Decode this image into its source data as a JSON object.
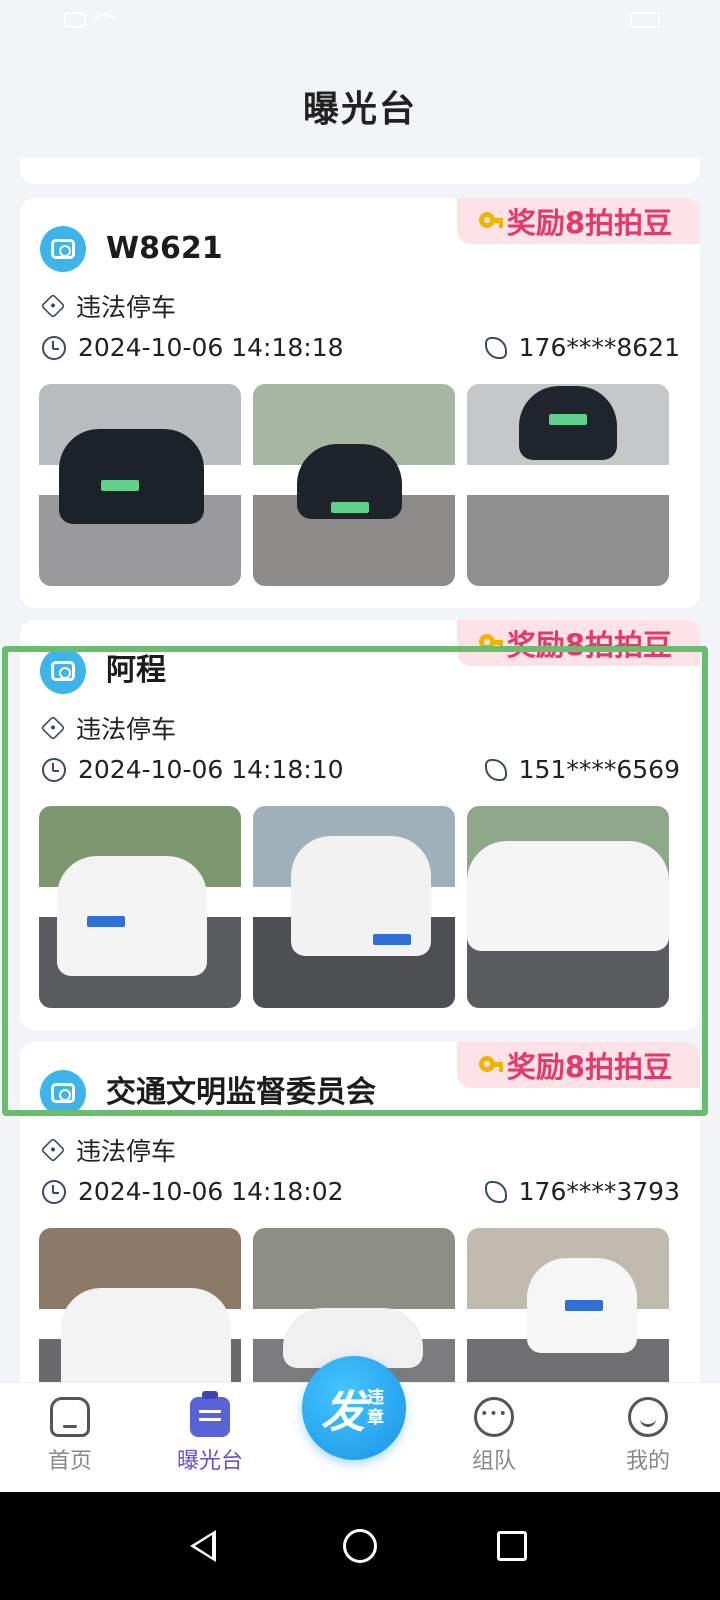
{
  "page_title": "曝光台",
  "cards": [
    {
      "username": "W8621",
      "reward": "奖励8拍拍豆",
      "violation": "违法停车",
      "time": "2024-10-06 14:18:18",
      "phone": "176****8621",
      "photos": [
        "dark-car-photo",
        "dark-car-photo",
        "dark-car-photo"
      ]
    },
    {
      "username": "阿程",
      "reward": "奖励8拍拍豆",
      "violation": "违法停车",
      "time": "2024-10-06 14:18:10",
      "phone": "151****6569",
      "photos": [
        "white-car-photo",
        "white-car-photo",
        "white-car-photo"
      ]
    },
    {
      "username": "交通文明监督委员会",
      "reward": "奖励8拍拍豆",
      "violation": "违法停车",
      "time": "2024-10-06 14:18:02",
      "phone": "176****3793",
      "photos": [
        "white-car-photo",
        "white-car-photo",
        "white-car-photo"
      ]
    }
  ],
  "fab": {
    "main": "发",
    "sub": "违章"
  },
  "tabs": [
    {
      "label": "首页",
      "icon": "home-icon"
    },
    {
      "label": "曝光台",
      "icon": "exposure-icon",
      "active": true
    },
    {
      "label": "组队",
      "icon": "chat-icon"
    },
    {
      "label": "我的",
      "icon": "profile-icon"
    }
  ],
  "colors": {
    "accent": "#6a4fd0",
    "reward": "#e5386b",
    "highlight": "#6abc6e",
    "fab": "#1a93e6"
  }
}
